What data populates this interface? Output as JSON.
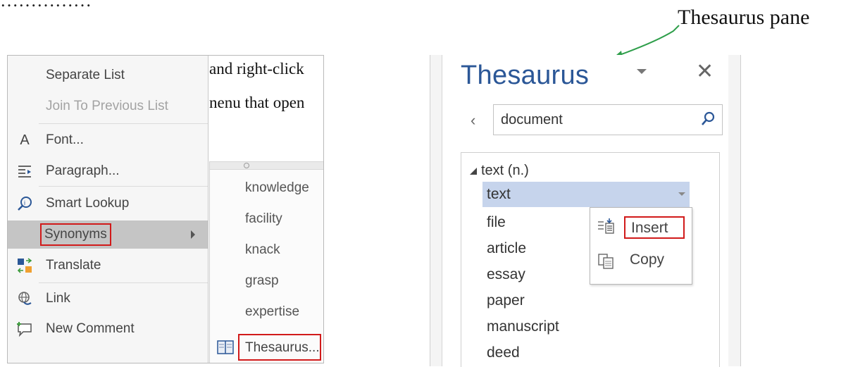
{
  "header_cut": "……………",
  "annotation": {
    "label": "Thesaurus pane"
  },
  "left": {
    "doc_text": [
      "and right-click",
      "nenu that open"
    ],
    "context_menu": {
      "items": [
        {
          "label": "Separate List",
          "icon": "none",
          "disabled": false
        },
        {
          "label": "Join To Previous List",
          "icon": "none",
          "disabled": true
        },
        {
          "label": "Font...",
          "icon": "font-icon",
          "disabled": false
        },
        {
          "label": "Paragraph...",
          "icon": "paragraph-icon",
          "disabled": false
        },
        {
          "label": "Smart Lookup",
          "icon": "smart-lookup-icon",
          "disabled": false
        },
        {
          "label": "Synonyms",
          "icon": "none",
          "disabled": false,
          "highlighted": true,
          "submenu": true
        },
        {
          "label": "Translate",
          "icon": "translate-icon",
          "disabled": false
        },
        {
          "label": "Link",
          "icon": "link-icon",
          "disabled": false
        },
        {
          "label": "New Comment",
          "icon": "comment-icon",
          "disabled": false
        }
      ]
    },
    "submenu": {
      "items": [
        "knowledge",
        "facility",
        "knack",
        "grasp",
        "expertise"
      ],
      "thesaurus_label": "Thesaurus..."
    }
  },
  "pane": {
    "title": "Thesaurus",
    "close_glyph": "✕",
    "back_glyph": "‹",
    "search_value": "document",
    "group_heading": "text (n.)",
    "words": [
      "text",
      "file",
      "article",
      "essay",
      "paper",
      "manuscript",
      "deed"
    ],
    "word_menu": {
      "insert": "Insert",
      "copy": "Copy"
    }
  },
  "colors": {
    "accent": "#2b5797",
    "highlight_box": "#d11a1a",
    "selected_row": "#c6d4ec",
    "arrow": "#2e9e4a"
  }
}
